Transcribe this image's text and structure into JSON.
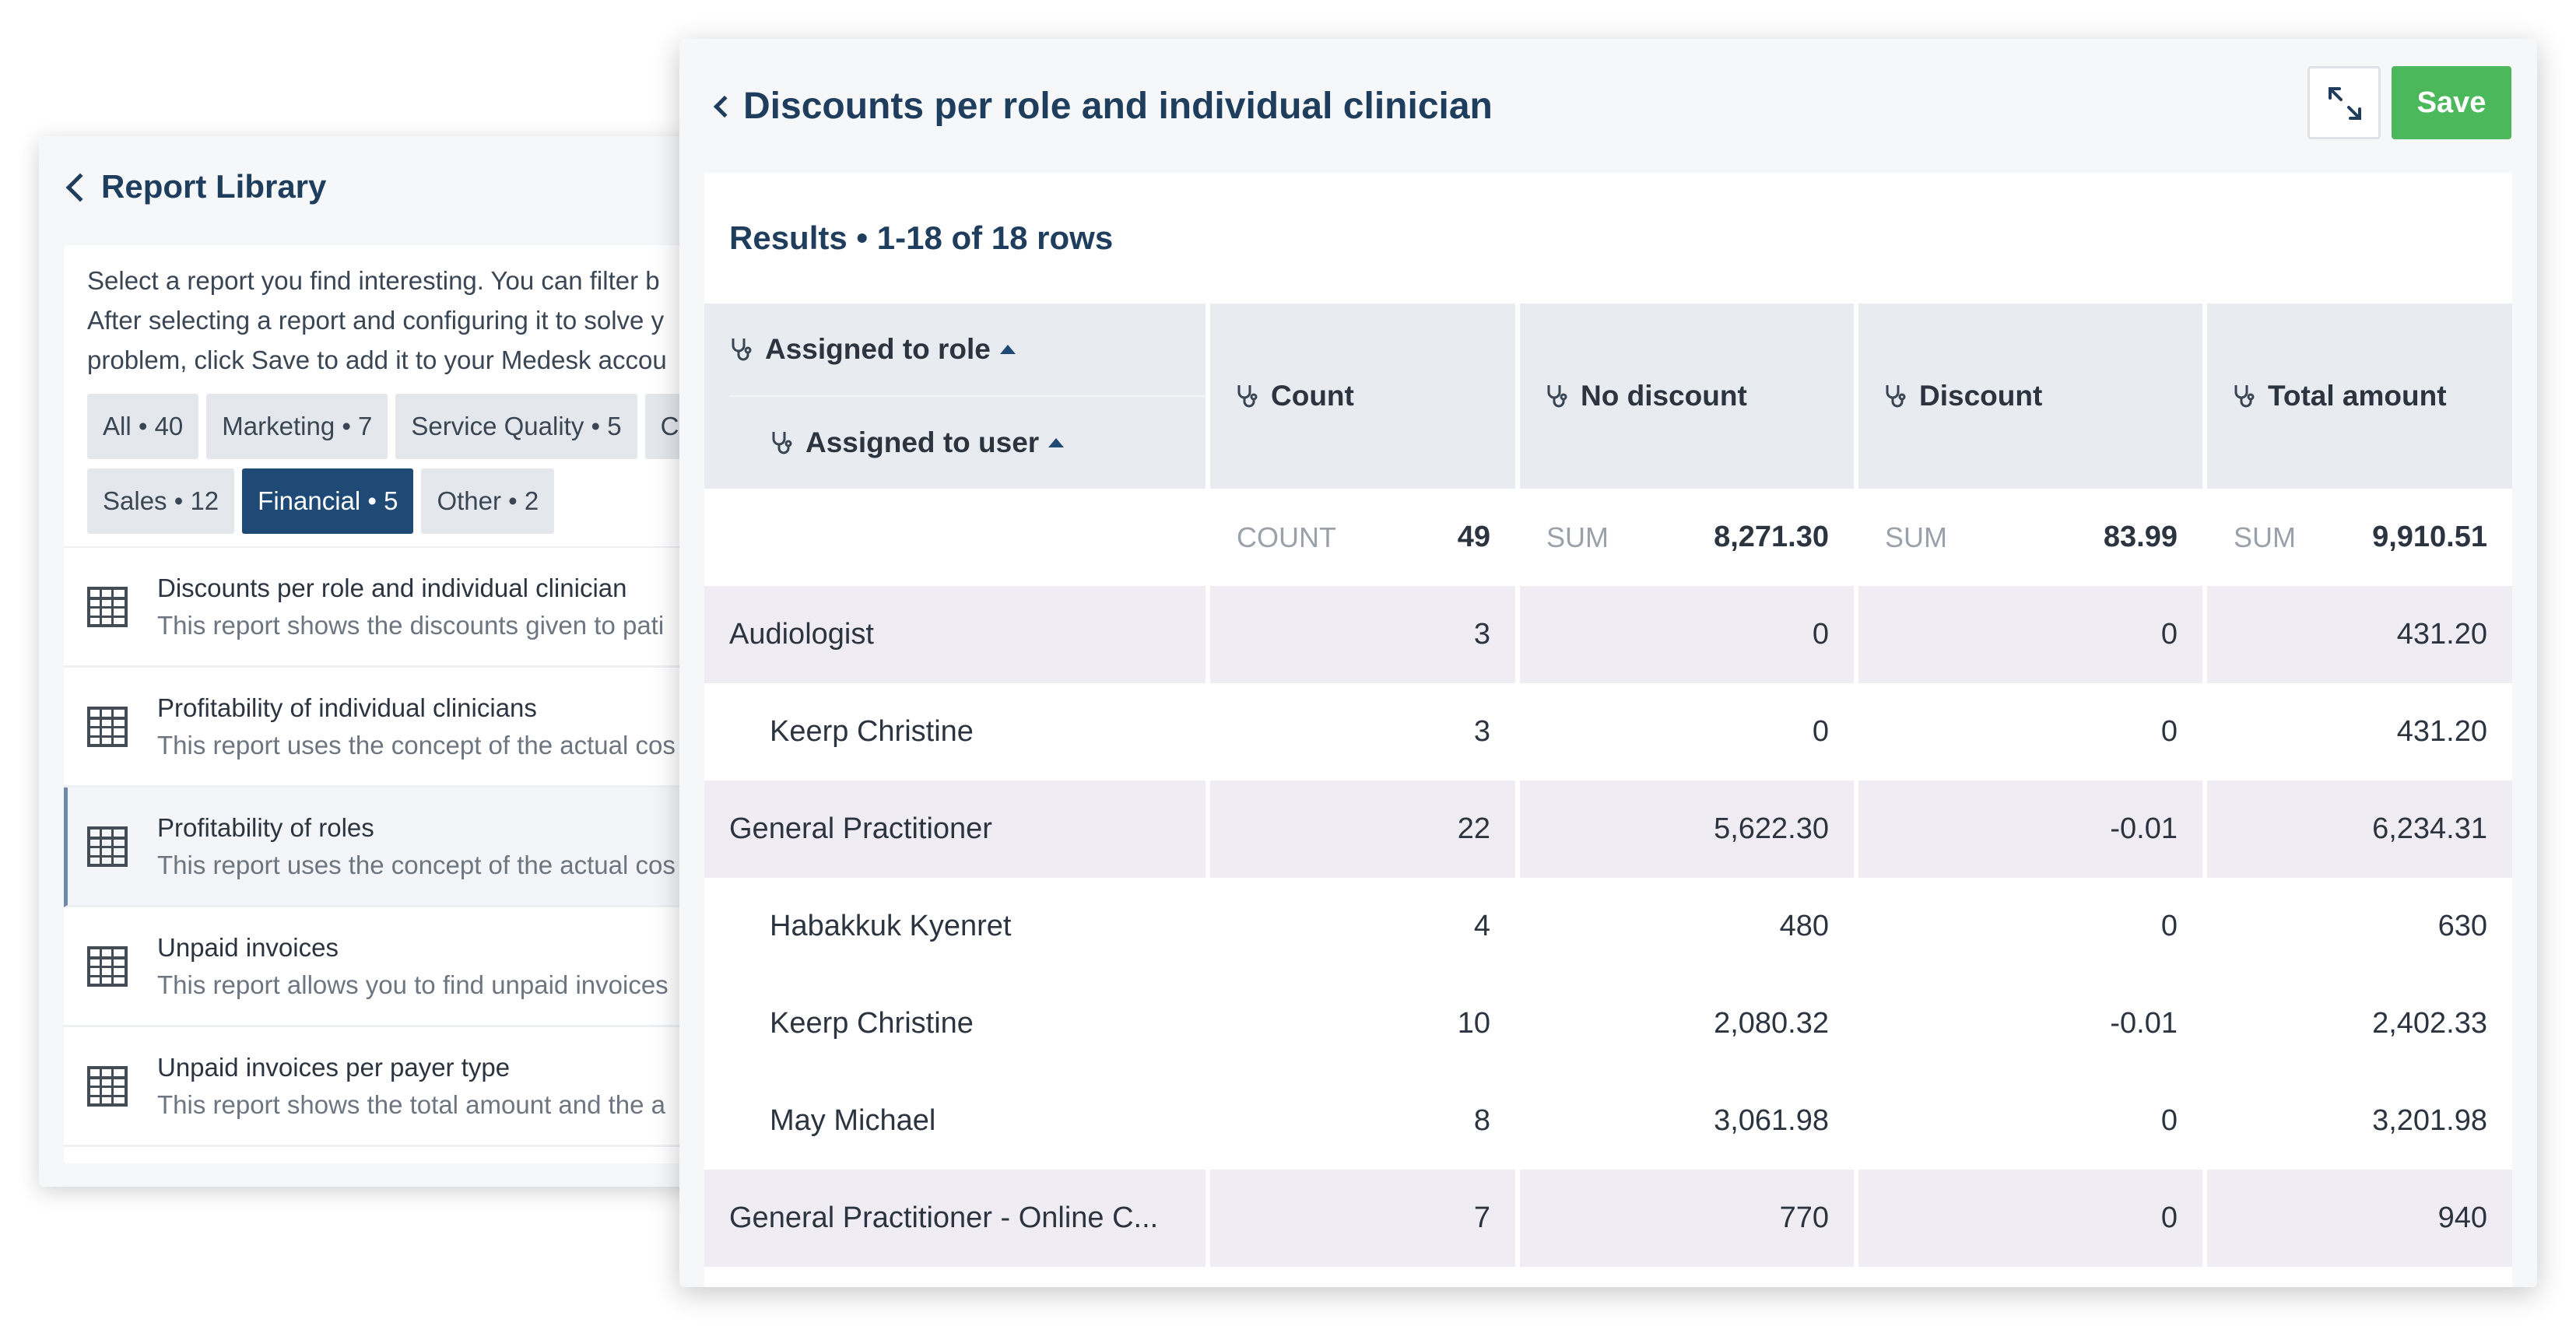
{
  "library": {
    "title": "Report Library",
    "description_lines": [
      "Select a report you find interesting. You can filter b",
      "After selecting a report and configuring it to solve y",
      "problem, click Save to add it to your Medesk accou"
    ],
    "filters_row1": [
      "All • 40",
      "Marketing • 7",
      "Service Quality • 5",
      "C"
    ],
    "filters_row2": [
      "Sales • 12",
      "Financial • 5",
      "Other • 2"
    ],
    "active_filter": "Financial • 5",
    "reports": [
      {
        "title": "Discounts per role and individual clinician",
        "subtitle": "This report shows the discounts given to pati"
      },
      {
        "title": "Profitability of individual clinicians",
        "subtitle": "This report uses the concept of the actual cos"
      },
      {
        "title": "Profitability of roles",
        "subtitle": "This report uses the concept of the actual cos",
        "selected": true
      },
      {
        "title": "Unpaid invoices",
        "subtitle": "This report allows you to find unpaid invoices"
      },
      {
        "title": "Unpaid invoices per payer type",
        "subtitle": "This report shows the total amount and the a"
      }
    ]
  },
  "detail": {
    "title": "Discounts per role and individual clinician",
    "save_label": "Save",
    "results_label": "Results • 1-18 of 18 rows",
    "headers": {
      "role": "Assigned to role",
      "user": "Assigned to user",
      "count": "Count",
      "no_discount": "No discount",
      "discount": "Discount",
      "total": "Total amount"
    },
    "summary": {
      "count_label": "COUNT",
      "count": "49",
      "no_discount_label": "SUM",
      "no_discount": "8,271.30",
      "discount_label": "SUM",
      "discount": "83.99",
      "total_label": "SUM",
      "total": "9,910.51"
    },
    "rows": [
      {
        "kind": "group",
        "name": "Audiologist",
        "count": "3",
        "no_discount": "0",
        "discount": "0",
        "total": "431.20"
      },
      {
        "kind": "sub",
        "name": "Keerp Christine",
        "count": "3",
        "no_discount": "0",
        "discount": "0",
        "total": "431.20"
      },
      {
        "kind": "group",
        "name": "General Practitioner",
        "count": "22",
        "no_discount": "5,622.30",
        "discount": "-0.01",
        "total": "6,234.31"
      },
      {
        "kind": "sub",
        "name": "Habakkuk Kyenret",
        "count": "4",
        "no_discount": "480",
        "discount": "0",
        "total": "630"
      },
      {
        "kind": "sub",
        "name": "Keerp Christine",
        "count": "10",
        "no_discount": "2,080.32",
        "discount": "-0.01",
        "total": "2,402.33"
      },
      {
        "kind": "sub",
        "name": "May Michael",
        "count": "8",
        "no_discount": "3,061.98",
        "discount": "0",
        "total": "3,201.98"
      },
      {
        "kind": "group",
        "name": "General Practitioner - Online C...",
        "count": "7",
        "no_discount": "770",
        "discount": "0",
        "total": "940"
      }
    ]
  },
  "colors": {
    "accent": "#1f4a75",
    "save": "#4cb85c",
    "group_row": "#f0ecf4",
    "header_bg": "#e8ebef"
  },
  "icons": [
    "chevron-left-icon",
    "table-icon",
    "expand-icon",
    "stethoscope-icon",
    "sort-ascending-icon"
  ]
}
